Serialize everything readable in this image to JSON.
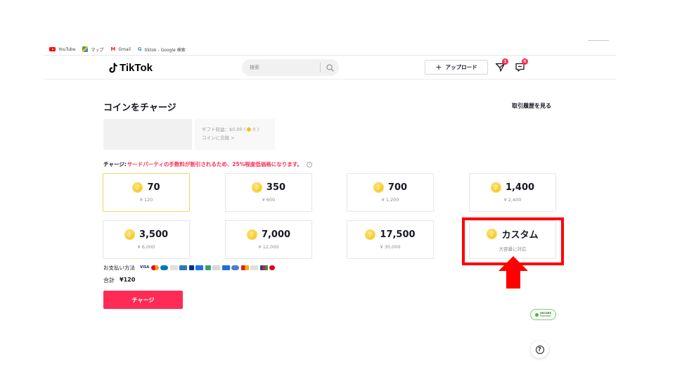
{
  "bookmarks": [
    {
      "label": "YouTube",
      "icon": "youtube-icon"
    },
    {
      "label": "マップ",
      "icon": "maps-icon"
    },
    {
      "label": "Gmail",
      "icon": "gmail-icon"
    },
    {
      "label": "tiktok - Google 検索",
      "icon": "google-icon"
    }
  ],
  "header": {
    "logo_text": "TikTok",
    "search_placeholder": "検索",
    "upload_label": "アップロード",
    "inbox_badge": "1",
    "messages_badge": "6"
  },
  "page": {
    "title": "コインをチャージ",
    "history_link": "取引履歴を見る",
    "gift_revenue": "ギフト収益：$0.00 (",
    "gift_revenue_coins": "0 )",
    "exchange_link": "コインに交換 >",
    "notice_lead": "チャージ:",
    "notice_text": "サードパーティの手数料が割引されるため、25%程度低価格になります。"
  },
  "packages": [
    {
      "amount": "70",
      "price": "¥ 120",
      "selected": true
    },
    {
      "amount": "350",
      "price": "¥ 600"
    },
    {
      "amount": "700",
      "price": "¥ 1,200"
    },
    {
      "amount": "1,400",
      "price": "¥ 2,400"
    },
    {
      "amount": "3,500",
      "price": "¥ 6,000"
    },
    {
      "amount": "7,000",
      "price": "¥ 12,000"
    },
    {
      "amount": "17,500",
      "price": "¥ 30,000"
    },
    {
      "amount": "カスタム",
      "price": "大容量に対応"
    }
  ],
  "payment": {
    "label": "お支払い方法",
    "visa_text": "VISA"
  },
  "total": {
    "label": "合計",
    "value": "¥120"
  },
  "charge_button": "チャージ",
  "secure_badge": {
    "line1": "SECURE",
    "line2": "Payment"
  },
  "colors": {
    "accent": "#fe2c55",
    "coin": "#f7c21a",
    "highlight": "#ff0000",
    "selected_border": "#f5d36a"
  }
}
